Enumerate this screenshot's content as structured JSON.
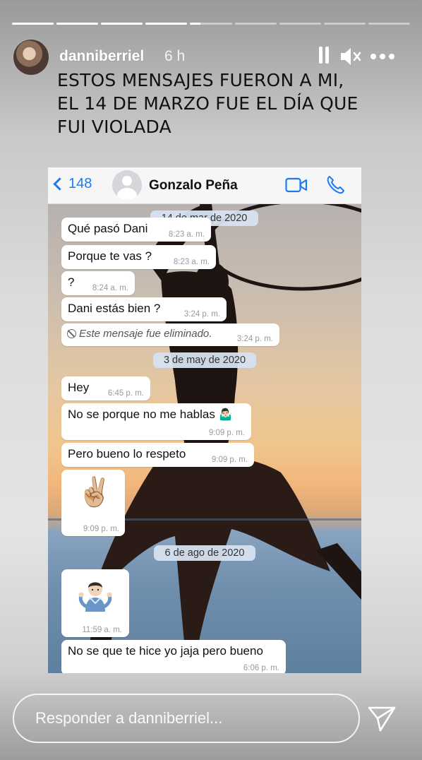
{
  "story": {
    "progress": [
      1,
      1,
      1,
      1,
      0.25,
      0,
      0,
      0,
      0
    ],
    "username": "danniberriel",
    "time_ago": "6 h",
    "caption": "ESTOS MENSAJES FUERON A MI,\nEL 14 DE MARZO FUE EL DÍA QUE\nFUI VIOLADA"
  },
  "chat": {
    "back_count": "148",
    "contact_name": "Gonzalo Peña",
    "dates": [
      "14 de mar de 2020",
      "3 de may de 2020",
      "6 de ago de 2020"
    ],
    "messages": [
      {
        "text": "Qué pasó Dani",
        "time": "8:23 a. m."
      },
      {
        "text": "Porque te vas ?",
        "time": "8:23 a. m."
      },
      {
        "text": "?",
        "time": "8:24 a. m."
      },
      {
        "text": "Dani estás bien ?",
        "time": "3:24 p. m."
      },
      {
        "text": "Este mensaje fue eliminado.",
        "time": "3:24 p. m."
      },
      {
        "text": "Hey",
        "time": "6:45 p. m."
      },
      {
        "text": "No se porque no me hablas",
        "time": "9:09 p. m."
      },
      {
        "text": "Pero bueno lo respeto",
        "time": "9:09 p. m."
      },
      {
        "text": "✌🏼",
        "time": "9:09 p. m."
      },
      {
        "text": "",
        "time": "11:59 a. m."
      },
      {
        "text": "No se que te hice yo jaja pero bueno",
        "time": "6:06 p. m."
      }
    ]
  },
  "reply": {
    "placeholder": "Responder a danniberriel..."
  },
  "icons": {
    "pause": "pause-icon",
    "mute": "speaker-muted-icon",
    "more": "more-icon",
    "video": "video-call-icon",
    "phone": "phone-call-icon",
    "send": "send-icon",
    "deleted": "deleted-message-icon",
    "shrug": "person-shrugging-emoji",
    "peace": "victory-hand-emoji"
  }
}
